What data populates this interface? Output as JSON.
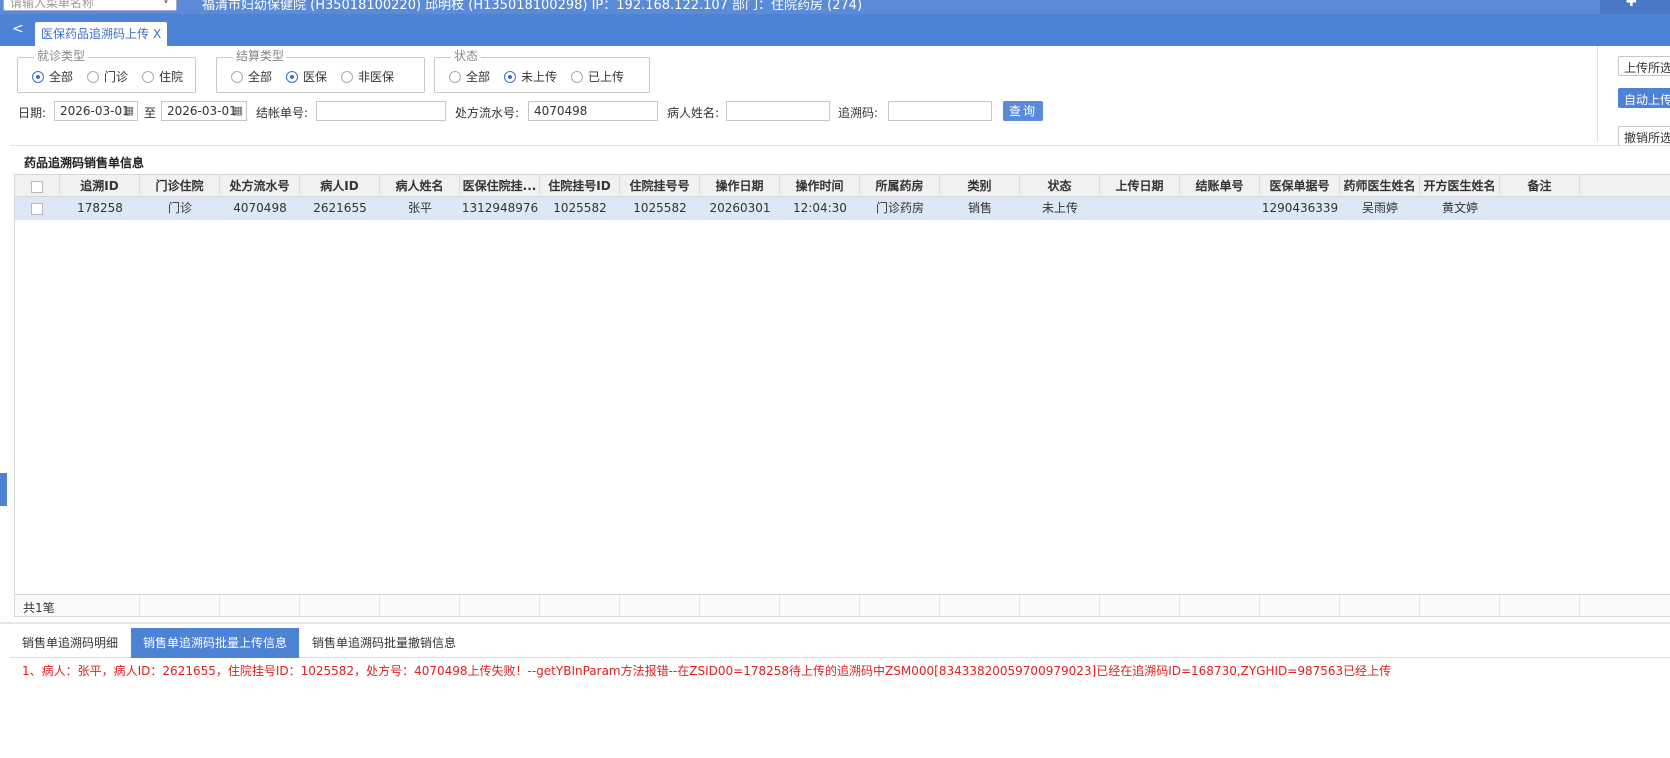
{
  "topbar": {
    "menu_search_placeholder": "请输入菜单名称",
    "info": "福清市妇幼保健院 (H35018100220) 邱明枝 (H135018100298) IP：192.168.122.107 部门：住院药房 (274)"
  },
  "tabbar": {
    "active_tab": "医保药品追溯码上传",
    "close": "X"
  },
  "filters": {
    "visit_type": {
      "legend": "就诊类型",
      "options": [
        "全部",
        "门诊",
        "住院"
      ],
      "selected": 0
    },
    "settle_type": {
      "legend": "结算类型",
      "options": [
        "全部",
        "医保",
        "非医保"
      ],
      "selected": 1
    },
    "status": {
      "legend": "状态",
      "options": [
        "全部",
        "未上传",
        "已上传"
      ],
      "selected": 1
    },
    "date_label": "日期:",
    "date_from": "2026-03-01",
    "to_label": "至",
    "date_to": "2026-03-01",
    "bill_label": "结帐单号:",
    "bill_value": "",
    "rx_label": "处方流水号:",
    "rx_value": "4070498",
    "patient_label": "病人姓名:",
    "patient_value": "",
    "trace_label": "追溯码:",
    "trace_value": "",
    "query_button": "查询"
  },
  "right_buttons": [
    "上传所选",
    "自动上传",
    "撤销所选"
  ],
  "grid": {
    "title": "药品追溯码销售单信息",
    "columns": [
      "追溯ID",
      "门诊住院",
      "处方流水号",
      "病人ID",
      "病人姓名",
      "医保住院挂...",
      "住院挂号ID",
      "住院挂号号",
      "操作日期",
      "操作时间",
      "所属药房",
      "类别",
      "状态",
      "上传日期",
      "结账单号",
      "医保单据号",
      "药师医生姓名",
      "开方医生姓名",
      "备注"
    ],
    "rows": [
      [
        "178258",
        "门诊",
        "4070498",
        "2621655",
        "张平",
        "1312948976",
        "1025582",
        "1025582",
        "20260301",
        "12:04:30",
        "门诊药房",
        "销售",
        "未上传",
        "",
        "",
        "1290436339",
        "吴雨婷",
        "黄文婷",
        ""
      ]
    ],
    "footer": "共1笔"
  },
  "bottom_tabs": [
    "销售单追溯码明细",
    "销售单追溯码批量上传信息",
    "销售单追溯码批量撤销信息"
  ],
  "bottom_active": 1,
  "message": "1、病人：张平，病人ID：2621655，住院挂号ID：1025582，处方号：4070498上传失败！--getYBInParam方法报错--在ZSID00=178258待上传的追溯码中ZSM000[83433820059700979023]已经在追溯码ID=168730,ZYGHID=987563已经上传",
  "colors": {
    "accent": "#4d82d4",
    "error": "#e02020",
    "selected_row": "#dde7f6"
  }
}
